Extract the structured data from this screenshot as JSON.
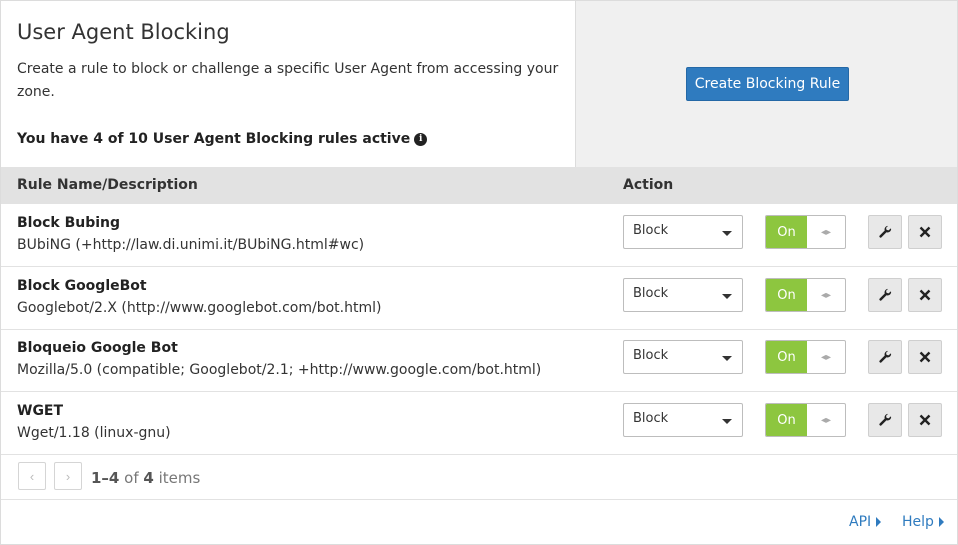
{
  "header": {
    "title": "User Agent Blocking",
    "description": "Create a rule to block or challenge a specific User Agent from accessing your zone.",
    "active_count": "You have 4 of 10 User Agent Blocking rules active",
    "info_glyph": "i",
    "create_button": "Create Blocking Rule"
  },
  "table": {
    "col_name": "Rule Name/Description",
    "col_action": "Action",
    "rows": [
      {
        "name": "Block Bubing",
        "ua": "BUbiNG (+http://law.di.unimi.it/BUbiNG.html#wc)",
        "action": "Block",
        "toggle": "On"
      },
      {
        "name": "Block GoogleBot",
        "ua": "Googlebot/2.X (http://www.googlebot.com/bot.html)",
        "action": "Block",
        "toggle": "On"
      },
      {
        "name": "Bloqueio Google Bot",
        "ua": "Mozilla/5.0 (compatible; Googlebot/2.1; +http://www.google.com/bot.html)",
        "action": "Block",
        "toggle": "On"
      },
      {
        "name": "WGET",
        "ua": "Wget/1.18 (linux-gnu)",
        "action": "Block",
        "toggle": "On"
      }
    ]
  },
  "pager": {
    "range": "1–4",
    "of": "of",
    "total": "4",
    "unit": "items",
    "prev_glyph": "‹",
    "next_glyph": "›"
  },
  "footer": {
    "api": "API",
    "help": "Help"
  },
  "icons": {
    "edit": "wrench-icon",
    "delete": "close-icon",
    "toggle_handle": "drag-handle-icon"
  },
  "colors": {
    "primary": "#2f7bbf",
    "toggle_on": "#8dc63f",
    "header_bg": "#e2e2e2"
  }
}
